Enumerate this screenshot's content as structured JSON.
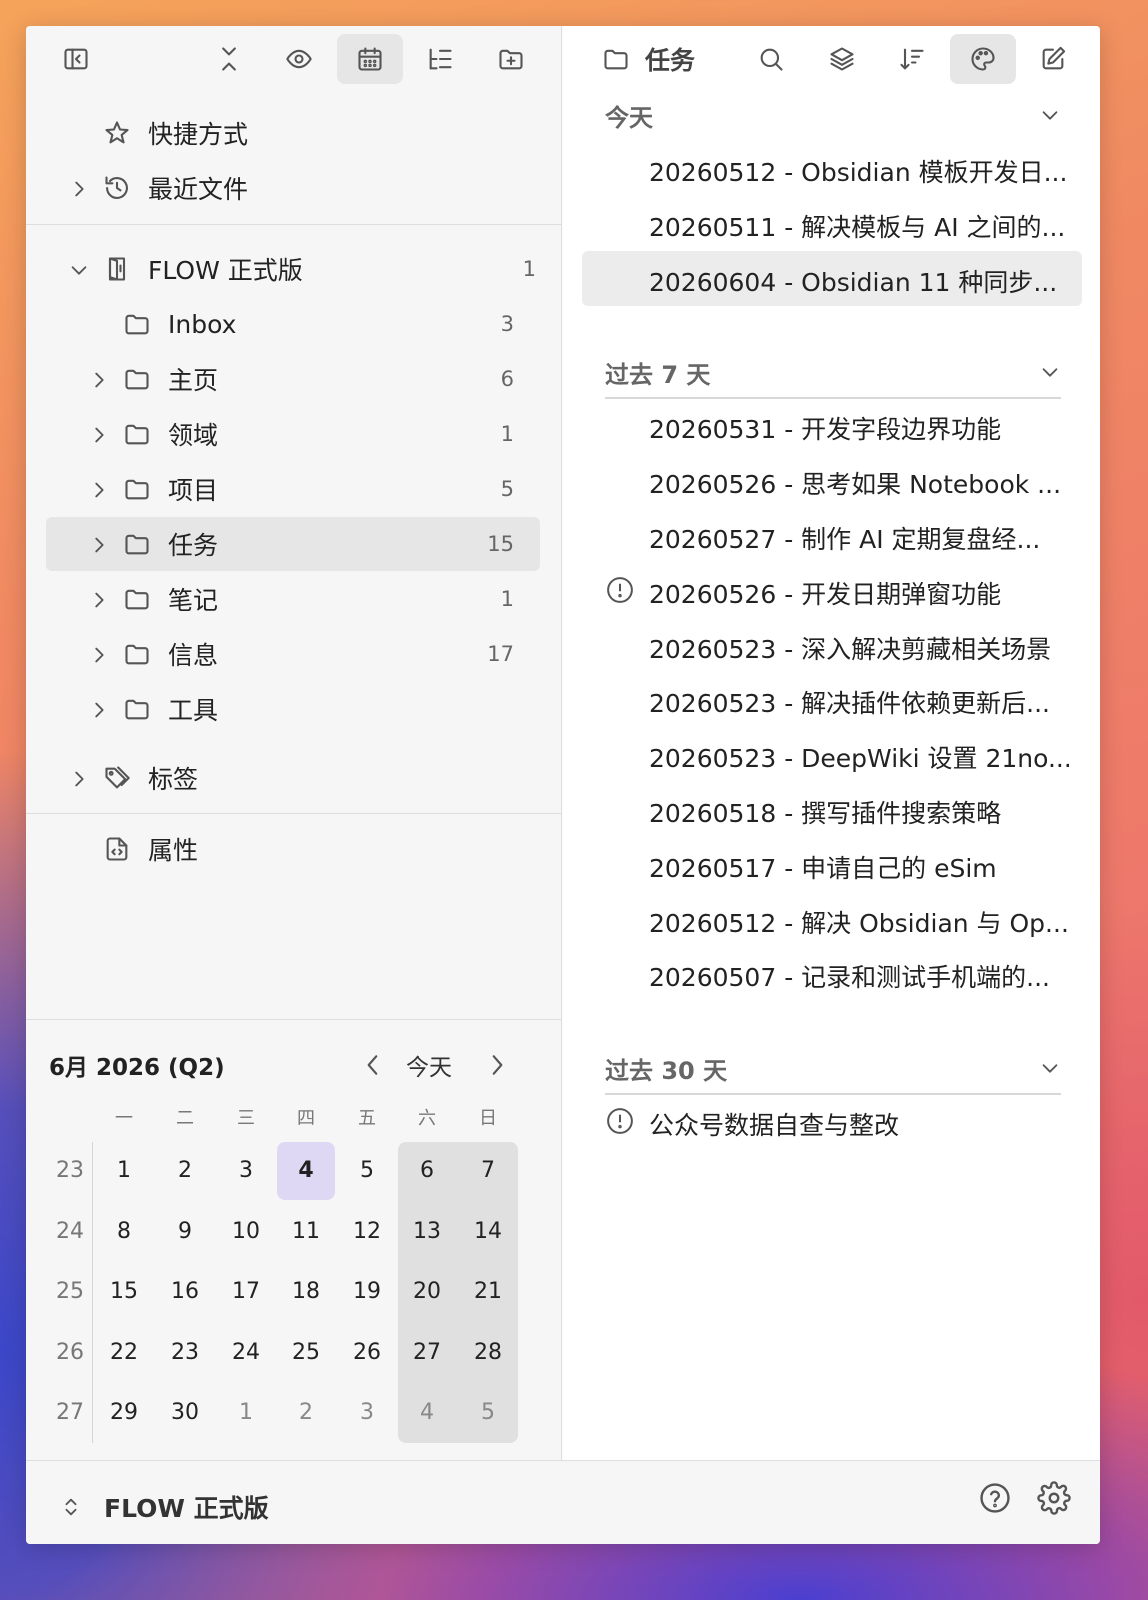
{
  "left_toolbar": {
    "buttons": [
      {
        "name": "collapse-sidebar-icon"
      },
      {
        "name": "collapse-all-icon"
      },
      {
        "name": "eye-icon"
      },
      {
        "name": "calendar-icon",
        "active": true
      },
      {
        "name": "outline-icon"
      },
      {
        "name": "new-folder-icon"
      }
    ]
  },
  "shortcuts": {
    "label": "快捷方式"
  },
  "recent": {
    "label": "最近文件"
  },
  "vault": {
    "label": "FLOW 正式版",
    "count": "1"
  },
  "folders": [
    {
      "label": "Inbox",
      "count": "3",
      "has_chevron": false
    },
    {
      "label": "主页",
      "count": "6",
      "has_chevron": true
    },
    {
      "label": "领域",
      "count": "1",
      "has_chevron": true
    },
    {
      "label": "项目",
      "count": "5",
      "has_chevron": true
    },
    {
      "label": "任务",
      "count": "15",
      "has_chevron": true,
      "selected": true
    },
    {
      "label": "笔记",
      "count": "1",
      "has_chevron": true
    },
    {
      "label": "信息",
      "count": "17",
      "has_chevron": true
    },
    {
      "label": "工具",
      "count": "",
      "has_chevron": true
    }
  ],
  "tags": {
    "label": "标签"
  },
  "properties": {
    "label": "属性"
  },
  "calendar": {
    "title": "6月 2026 (Q2)",
    "today_label": "今天",
    "weekdays": [
      "一",
      "二",
      "三",
      "四",
      "五",
      "六",
      "日"
    ],
    "weeks": [
      {
        "week": "23",
        "days": [
          "1",
          "2",
          "3",
          "4",
          "5",
          "6",
          "7"
        ]
      },
      {
        "week": "24",
        "days": [
          "8",
          "9",
          "10",
          "11",
          "12",
          "13",
          "14"
        ]
      },
      {
        "week": "25",
        "days": [
          "15",
          "16",
          "17",
          "18",
          "19",
          "20",
          "21"
        ]
      },
      {
        "week": "26",
        "days": [
          "22",
          "23",
          "24",
          "25",
          "26",
          "27",
          "28"
        ]
      },
      {
        "week": "27",
        "days": [
          "29",
          "30",
          "1",
          "2",
          "3",
          "4",
          "5"
        ]
      }
    ],
    "today_date": "4"
  },
  "right_header": {
    "title": "任务"
  },
  "sections": [
    {
      "title": "今天",
      "items": [
        {
          "text": "20260512 - Obsidian 模板开发日...",
          "alert": false
        },
        {
          "text": "20260511 - 解决模板与 AI 之间的...",
          "alert": false
        },
        {
          "text": "20260604 - Obsidian 11 种同步...",
          "alert": false,
          "selected": true
        }
      ]
    },
    {
      "title": "过去 7 天",
      "items": [
        {
          "text": "20260531 - 开发字段边界功能",
          "alert": false
        },
        {
          "text": "20260526 - 思考如果 Notebook ...",
          "alert": false
        },
        {
          "text": "20260527 - 制作 AI 定期复盘经...",
          "alert": false
        },
        {
          "text": "20260526 - 开发日期弹窗功能",
          "alert": true
        },
        {
          "text": "20260523 - 深入解决剪藏相关场景",
          "alert": false
        },
        {
          "text": "20260523 - 解决插件依赖更新后...",
          "alert": false
        },
        {
          "text": "20260523 - DeepWiki 设置 21no...",
          "alert": false
        },
        {
          "text": "20260518 - 撰写插件搜索策略",
          "alert": false
        },
        {
          "text": "20260517 - 申请自己的 eSim",
          "alert": false
        },
        {
          "text": "20260512 - 解决 Obsidian 与 Op...",
          "alert": false
        },
        {
          "text": "20260507 - 记录和测试手机端的...",
          "alert": false
        }
      ]
    },
    {
      "title": "过去 30 天",
      "items": [
        {
          "text": "公众号数据自查与整改",
          "alert": true
        }
      ]
    }
  ],
  "footer": {
    "vault_name": "FLOW 正式版"
  }
}
